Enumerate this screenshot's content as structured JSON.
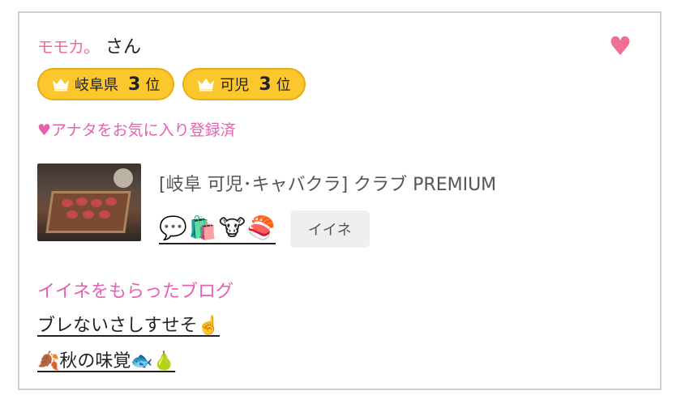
{
  "user": {
    "nickname": "モモカ。",
    "honorific": "さん",
    "favorite_icon": "heart-icon"
  },
  "ranks": [
    {
      "area": "岐阜県",
      "rank": "3",
      "suffix": "位"
    },
    {
      "area": "可児",
      "rank": "3",
      "suffix": "位"
    }
  ],
  "favorited_text": "♥アナタをお気に入り登録済",
  "shop": {
    "title": "[岐阜 可児･キャバクラ]  クラブ PREMIUM",
    "emoji_tags": [
      "💬",
      "🛍️",
      "🐮",
      "🍣"
    ],
    "iine_label": "イイネ"
  },
  "blog": {
    "heading": "イイネをもらったブログ",
    "posts": [
      {
        "title": "ブレないさしすせそ☝️"
      },
      {
        "title": "🍂秋の味覚🐟🍐"
      }
    ]
  },
  "colors": {
    "accent_pink": "#e85fb2",
    "heart": "#f06f95",
    "rank_badge": "#fcc72c",
    "border": "#d0d0d0"
  }
}
